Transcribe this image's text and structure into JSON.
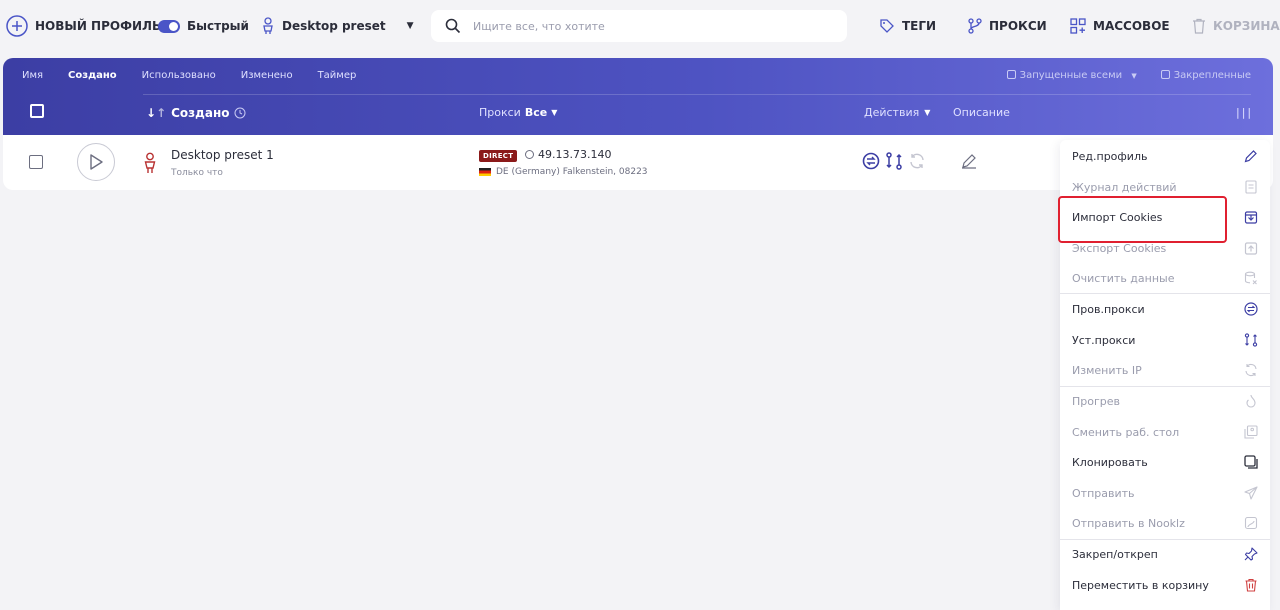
{
  "toolbar": {
    "new_profile": "НОВЫЙ ПРОФИЛЬ",
    "fast": "Быстрый",
    "preset": "Desktop preset",
    "search_placeholder": "Ищите все, что хотите",
    "tags": "ТЕГИ",
    "proxies": "ПРОКСИ",
    "bulk": "МАССОВОЕ",
    "trash": "КОРЗИНА"
  },
  "table": {
    "sort_tabs": [
      "Имя",
      "Создано",
      "Использовано",
      "Изменено",
      "Таймер"
    ],
    "active_sort": "Создано",
    "filter_running": "Запущенные всеми",
    "filter_pinned": "Закрепленные",
    "col_created": "Создано",
    "col_proxy": "Прокси",
    "col_proxy_filter": "Все",
    "col_actions": "Действия",
    "col_description": "Описание",
    "col_menu": "|||"
  },
  "profile": {
    "name": "Desktop preset 1",
    "created": "Только что",
    "proxy_type": "DIRECT",
    "ip": "49.13.73.140",
    "location": "DE (Germany) Falkenstein, 08223"
  },
  "menu": {
    "items": [
      {
        "label": "Ред.профиль",
        "icon": "pencil-icon",
        "enabled": true
      },
      {
        "label": "Журнал действий",
        "icon": "log-icon",
        "enabled": false
      },
      {
        "label": "Импорт Cookies",
        "icon": "import-cookies-icon",
        "enabled": true,
        "highlighted": true
      },
      {
        "label": "Экспорт Cookies",
        "icon": "export-cookies-icon",
        "enabled": false
      },
      {
        "label": "Очистить данные",
        "icon": "clear-data-icon",
        "enabled": false
      },
      {
        "label": "Пров.прокси",
        "icon": "check-proxy-icon",
        "enabled": true
      },
      {
        "label": "Уст.прокси",
        "icon": "set-proxy-icon",
        "enabled": true
      },
      {
        "label": "Изменить IP",
        "icon": "refresh-icon",
        "enabled": false
      },
      {
        "label": "Прогрев",
        "icon": "warmup-icon",
        "enabled": false
      },
      {
        "label": "Сменить раб. стол",
        "icon": "desktop-switch-icon",
        "enabled": false
      },
      {
        "label": "Клонировать",
        "icon": "clone-icon",
        "enabled": true
      },
      {
        "label": "Отправить",
        "icon": "send-icon",
        "enabled": false
      },
      {
        "label": "Отправить в Nooklz",
        "icon": "nooklz-icon",
        "enabled": false
      },
      {
        "label": "Закреп/откреп",
        "icon": "pin-icon",
        "enabled": true
      },
      {
        "label": "Переместить в корзину",
        "icon": "trash-icon",
        "enabled": true
      }
    ]
  },
  "colors": {
    "accent": "#4a55c7",
    "header_gradient_start": "#3c3ea4",
    "header_gradient_end": "#6d6fdc",
    "highlight_border": "#e02030",
    "direct_badge": "#8b1a1a",
    "person_icon": "#b83232"
  }
}
